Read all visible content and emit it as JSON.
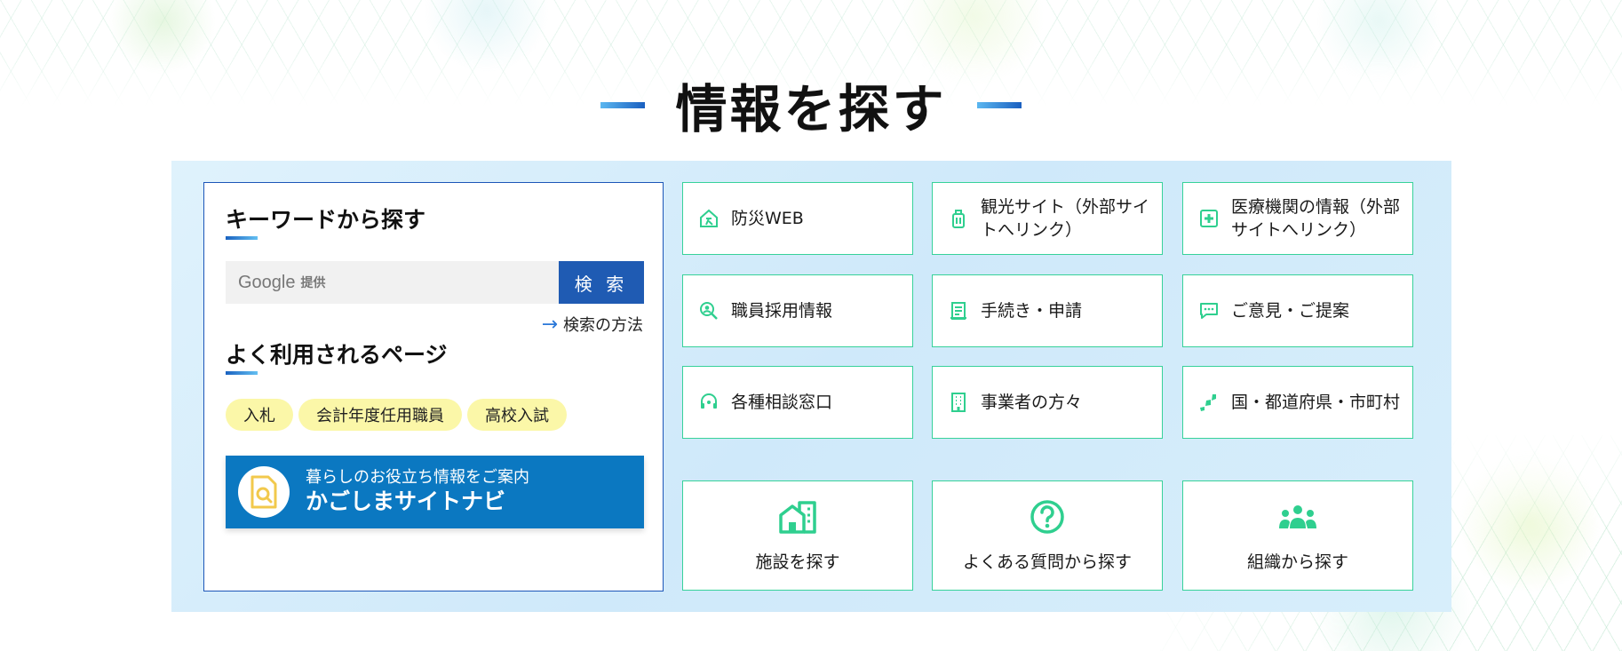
{
  "section_heading": "情報を探す",
  "keyword": {
    "title": "キーワードから探す",
    "search_placeholder_brand": "Google",
    "search_placeholder_sub": "提供",
    "search_button": "検 索",
    "how_link": "検索の方法"
  },
  "popular": {
    "title": "よく利用されるページ",
    "pills": [
      "入札",
      "会計年度任用職員",
      "高校入試"
    ]
  },
  "navi_banner": {
    "subtitle": "暮らしのお役立ち情報をご案内",
    "title": "かごしまサイトナビ"
  },
  "tiles": [
    {
      "label": "防災WEB",
      "icon": "disaster-icon"
    },
    {
      "label": "観光サイト（外部サイトへリンク）",
      "icon": "luggage-icon"
    },
    {
      "label": "医療機関の情報（外部サイトへリンク）",
      "icon": "medical-cross-icon"
    },
    {
      "label": "職員採用情報",
      "icon": "person-search-icon"
    },
    {
      "label": "手続き・申請",
      "icon": "form-icon"
    },
    {
      "label": "ご意見・ご提案",
      "icon": "chat-icon"
    },
    {
      "label": "各種相談窓口",
      "icon": "headset-icon"
    },
    {
      "label": "事業者の方々",
      "icon": "building-icon"
    },
    {
      "label": "国・都道府県・市町村",
      "icon": "map-icon"
    }
  ],
  "big_tiles": [
    {
      "label": "施設を探す",
      "icon": "facility-icon"
    },
    {
      "label": "よくある質問から探す",
      "icon": "question-icon"
    },
    {
      "label": "組織から探す",
      "icon": "group-icon"
    }
  ],
  "colors": {
    "accent_blue": "#1f5bb3",
    "tile_border": "#37d29a",
    "icon_green": "#2fcf8f",
    "panel_bg": "#d7eefb",
    "pill_bg": "#fbf7a8",
    "navi_bg": "#0b78c1"
  }
}
